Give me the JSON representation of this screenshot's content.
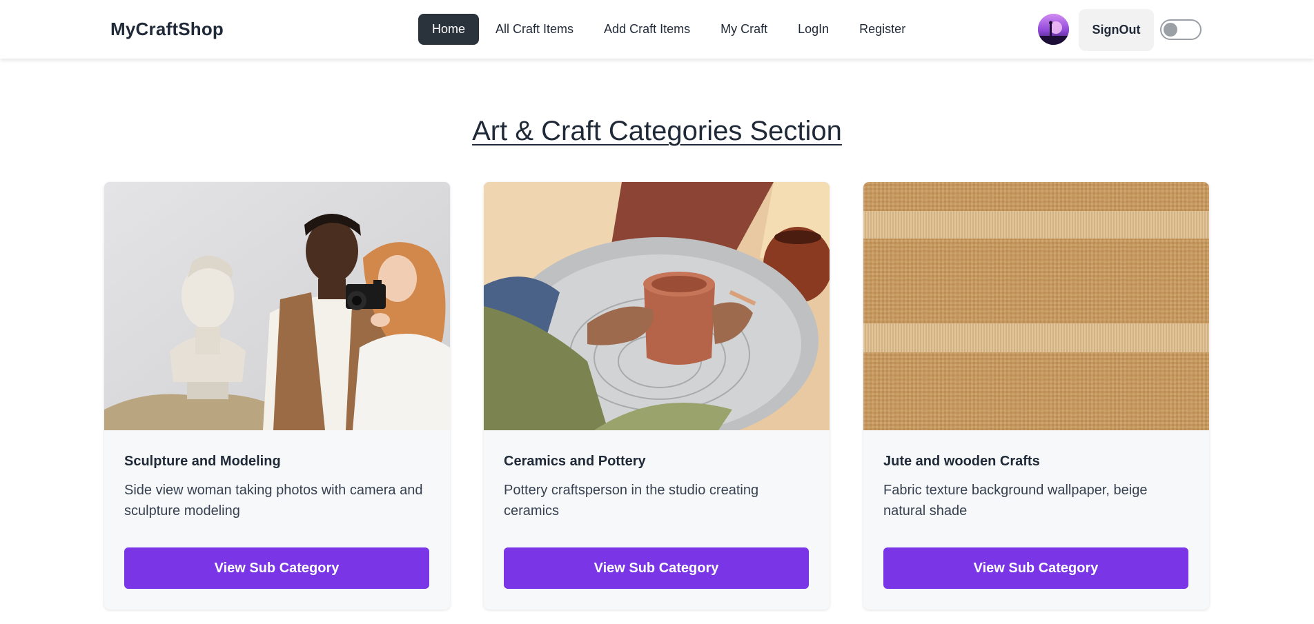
{
  "navbar": {
    "brand": "MyCraftShop",
    "items": [
      {
        "label": "Home",
        "active": true
      },
      {
        "label": "All Craft Items",
        "active": false
      },
      {
        "label": "Add Craft Items",
        "active": false
      },
      {
        "label": "My Craft",
        "active": false
      },
      {
        "label": "LogIn",
        "active": false
      },
      {
        "label": "Register",
        "active": false
      }
    ],
    "signout_label": "SignOut",
    "theme_toggle_on": false,
    "active_bg_color": "#2a323c"
  },
  "section": {
    "title": "Art & Craft Categories Section"
  },
  "categories": [
    {
      "title": "Sculpture and Modeling",
      "description": "Side view woman taking photos with camera and sculpture modeling",
      "button_label": "View Sub Category",
      "image_icon": "photo-sculpture-camera"
    },
    {
      "title": "Ceramics and Pottery",
      "description": "Pottery craftsperson in the studio creating ceramics",
      "button_label": "View Sub Category",
      "image_icon": "photo-pottery-wheel"
    },
    {
      "title": "Jute and wooden Crafts",
      "description": "Fabric texture background wallpaper, beige natural shade",
      "button_label": "View Sub Category",
      "image_icon": "photo-fabric-texture"
    }
  ],
  "colors": {
    "button_purple": "#7a36e6",
    "card_bg": "#f7f8f9",
    "text_dark": "#1f2937"
  }
}
